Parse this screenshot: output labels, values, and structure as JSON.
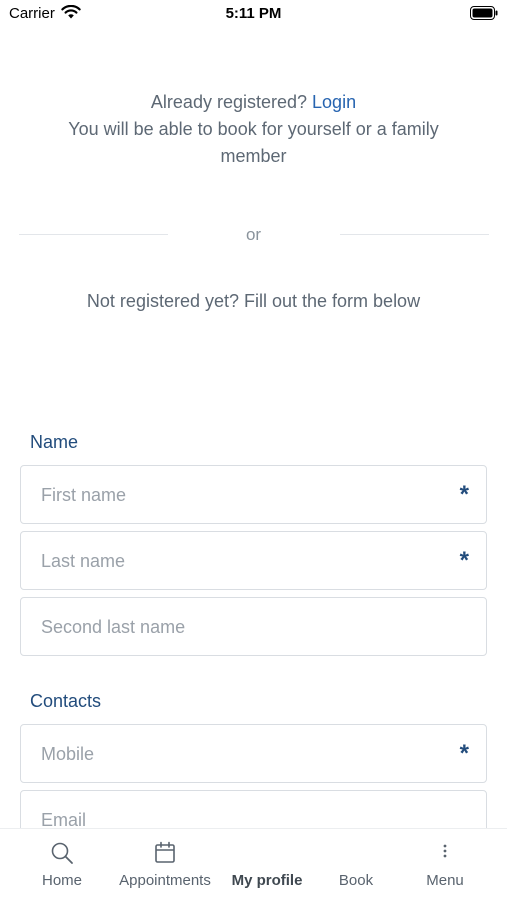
{
  "status_bar": {
    "carrier": "Carrier",
    "time": "5:11 PM"
  },
  "intro": {
    "already_registered": "Already registered?",
    "login_link": "Login",
    "booking_note": "You will be able to book for yourself or a family member"
  },
  "separator_text": "or",
  "not_registered": "Not registered yet? Fill out the form below",
  "name_section": {
    "title": "Name",
    "fields": [
      {
        "placeholder": "First name",
        "required": "*"
      },
      {
        "placeholder": "Last name",
        "required": "*"
      },
      {
        "placeholder": "Second last name"
      }
    ]
  },
  "contacts_section": {
    "title": "Contacts",
    "fields": [
      {
        "placeholder": "Mobile",
        "required": "*"
      },
      {
        "placeholder": "Email"
      }
    ]
  },
  "tab_bar": {
    "items": [
      {
        "label": "Home",
        "icon": "search-icon"
      },
      {
        "label": "Appointments",
        "icon": "calendar-icon"
      },
      {
        "label": "My profile",
        "icon": "none",
        "active": true
      },
      {
        "label": "Book",
        "icon": "none"
      },
      {
        "label": "Menu",
        "icon": "more-vertical-icon"
      }
    ]
  }
}
